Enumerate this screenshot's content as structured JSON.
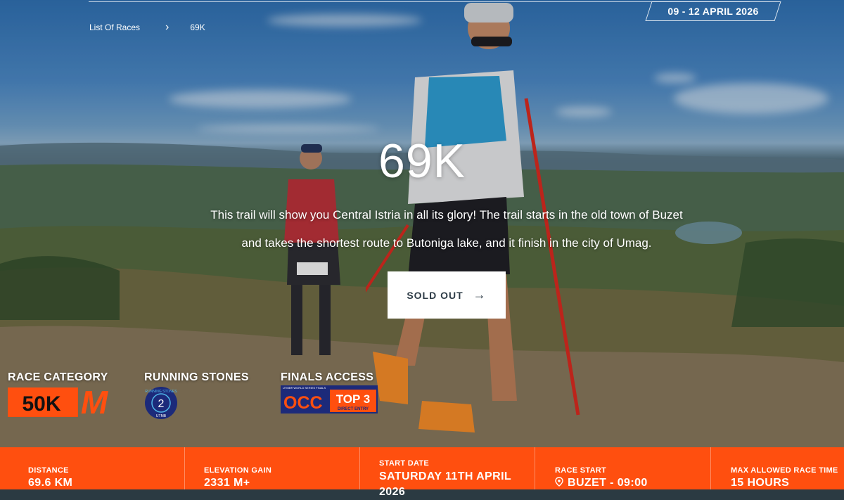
{
  "event": {
    "dates": "09 - 12 APRIL 2026"
  },
  "breadcrumb": {
    "items": [
      "List Of Races",
      "69K"
    ]
  },
  "race": {
    "title": "69K",
    "description": "This trail will show you Central Istria in all its glory! The trail starts in the old town of Buzet and takes the shortest route to Butoniga lake, and it finish in the city of Umag.",
    "cta_label": "SOLD OUT"
  },
  "badges": {
    "race_category": {
      "label": "RACE CATEGORY",
      "logo_text": "50K",
      "logo_letter": "M"
    },
    "running_stones": {
      "label": "RUNNING STONES",
      "count": "2",
      "ring_top": "RUNNING STONES",
      "ring_bottom": "UTMB"
    },
    "finals_access": {
      "label": "FINALS ACCESS",
      "occ": "OCC",
      "top": "TOP 3",
      "sub": "DIRECT ENTRY",
      "tiny": "UTMB® WORLD SERIES FINALS"
    }
  },
  "stats": [
    {
      "label": "DISTANCE",
      "value": "69.6 KM"
    },
    {
      "label": "ELEVATION GAIN",
      "value": "2331 M+"
    },
    {
      "label": "START DATE",
      "value": "SATURDAY 11TH APRIL 2026"
    },
    {
      "label": "RACE START",
      "value": "BUZET - 09:00"
    },
    {
      "label": "MAX ALLOWED RACE TIME",
      "value": "15 HOURS"
    }
  ],
  "colors": {
    "accent": "#ff4f0f",
    "category": "#ff4f0f",
    "occ_blue": "#1c2a7a"
  },
  "icons": {
    "breadcrumb_separator": "chevron-right-icon",
    "cta_arrow": "arrow-right-icon",
    "race_start": "location-pin-icon"
  }
}
